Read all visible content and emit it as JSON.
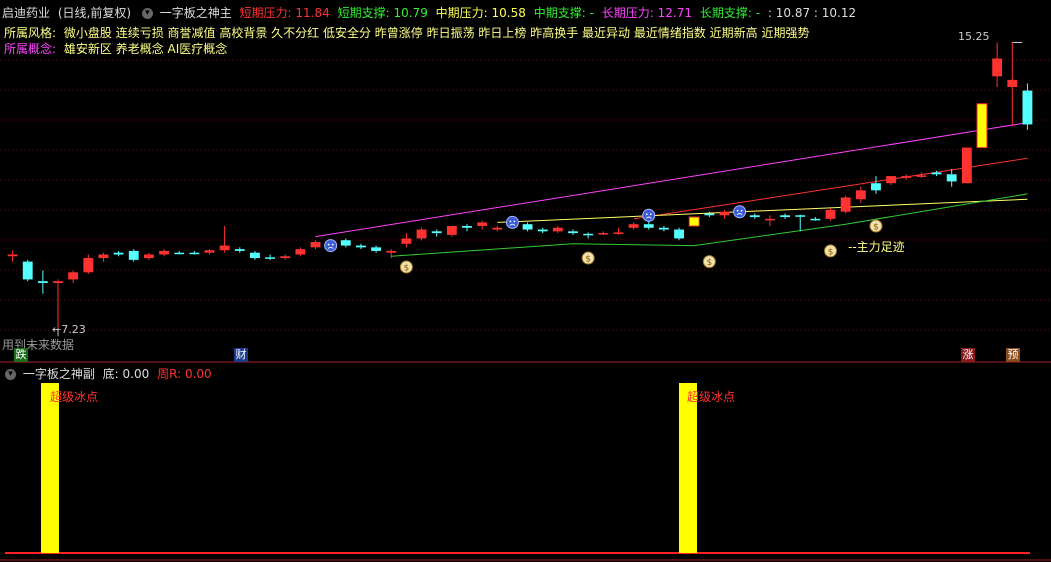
{
  "header": {
    "stock": "启迪药业",
    "period": "(日线,前复权)",
    "indicator": "一字板之神主",
    "short_pressure_label": "短期压力:",
    "short_pressure": "11.84",
    "short_support_label": "短期支撑:",
    "short_support": "10.79",
    "mid_pressure_label": "中期压力:",
    "mid_pressure": "10.58",
    "mid_support_label": "中期支撑:",
    "mid_support": "-",
    "long_pressure_label": "长期压力:",
    "long_pressure": "12.71",
    "long_support_label": "长期支撑:",
    "long_support": "-",
    "extra": ": 10.87 : 10.12"
  },
  "styles_row": {
    "label": "所属风格:",
    "value": "微小盘股 连续亏损 商誉减值 高校背景 久不分红 低安全分 昨曾涨停 昨日振荡 昨日上榜 昨高换手 最近异动 最近情绪指数 近期新高 近期强势"
  },
  "concepts_row": {
    "label": "所属概念:",
    "value": "雄安新区 养老概念 AI医疗概念"
  },
  "annotations": {
    "high_label": "15.25",
    "low_label": "←7.23",
    "main_force": "--主力足迹",
    "future_data": "用到未来数据",
    "marker_die": "跌",
    "marker_cai": "财",
    "marker_zhang": "涨",
    "marker_yu": "预"
  },
  "sub": {
    "title": "一字板之神副",
    "di_label": "底:",
    "di_value": "0.00",
    "zhou_label": "周R:",
    "zhou_value": "0.00",
    "bar_label": "超级冰点"
  },
  "colors": {
    "up": "#ff3232",
    "down": "#54ffff",
    "limit": "#ffff00",
    "short_line": "#ff44ff",
    "mid_line": "#ff3030",
    "long_line": "#ffff66",
    "support_line": "#33cc33"
  },
  "chart_data": {
    "type": "candlestick",
    "candles": [
      {
        "o": 9.3,
        "h": 9.4,
        "l": 9.1,
        "c": 9.25,
        "dir": "up"
      },
      {
        "o": 9.1,
        "h": 9.15,
        "l": 8.55,
        "c": 8.6,
        "dir": "down"
      },
      {
        "o": 8.55,
        "h": 8.85,
        "l": 8.2,
        "c": 8.5,
        "dir": "down"
      },
      {
        "o": 8.5,
        "h": 8.6,
        "l": 7.23,
        "c": 8.55,
        "dir": "up"
      },
      {
        "o": 8.6,
        "h": 8.85,
        "l": 8.5,
        "c": 8.8,
        "dir": "up"
      },
      {
        "o": 8.8,
        "h": 9.3,
        "l": 8.75,
        "c": 9.2,
        "dir": "up"
      },
      {
        "o": 9.2,
        "h": 9.35,
        "l": 9.1,
        "c": 9.3,
        "dir": "up"
      },
      {
        "o": 9.3,
        "h": 9.4,
        "l": 9.25,
        "c": 9.35,
        "dir": "down"
      },
      {
        "o": 9.4,
        "h": 9.45,
        "l": 9.1,
        "c": 9.15,
        "dir": "down"
      },
      {
        "o": 9.2,
        "h": 9.35,
        "l": 9.15,
        "c": 9.3,
        "dir": "up"
      },
      {
        "o": 9.3,
        "h": 9.45,
        "l": 9.25,
        "c": 9.4,
        "dir": "up"
      },
      {
        "o": 9.35,
        "h": 9.4,
        "l": 9.3,
        "c": 9.35,
        "dir": "down"
      },
      {
        "o": 9.35,
        "h": 9.4,
        "l": 9.3,
        "c": 9.35,
        "dir": "down"
      },
      {
        "o": 9.35,
        "h": 9.45,
        "l": 9.3,
        "c": 9.42,
        "dir": "up"
      },
      {
        "o": 9.42,
        "h": 10.1,
        "l": 9.35,
        "c": 9.55,
        "dir": "up"
      },
      {
        "o": 9.45,
        "h": 9.5,
        "l": 9.35,
        "c": 9.4,
        "dir": "down"
      },
      {
        "o": 9.35,
        "h": 9.4,
        "l": 9.15,
        "c": 9.2,
        "dir": "down"
      },
      {
        "o": 9.2,
        "h": 9.3,
        "l": 9.15,
        "c": 9.22,
        "dir": "down"
      },
      {
        "o": 9.2,
        "h": 9.3,
        "l": 9.15,
        "c": 9.25,
        "dir": "up"
      },
      {
        "o": 9.3,
        "h": 9.5,
        "l": 9.25,
        "c": 9.45,
        "dir": "up"
      },
      {
        "o": 9.5,
        "h": 9.7,
        "l": 9.45,
        "c": 9.65,
        "dir": "up"
      },
      {
        "o": 9.65,
        "h": 9.7,
        "l": 9.6,
        "c": 9.68,
        "dir": "down"
      },
      {
        "o": 9.7,
        "h": 9.75,
        "l": 9.5,
        "c": 9.55,
        "dir": "down"
      },
      {
        "o": 9.55,
        "h": 9.6,
        "l": 9.45,
        "c": 9.5,
        "dir": "down"
      },
      {
        "o": 9.5,
        "h": 9.55,
        "l": 9.35,
        "c": 9.4,
        "dir": "down"
      },
      {
        "o": 9.35,
        "h": 9.45,
        "l": 9.2,
        "c": 9.4,
        "dir": "up"
      },
      {
        "o": 9.6,
        "h": 9.9,
        "l": 9.5,
        "c": 9.75,
        "dir": "up"
      },
      {
        "o": 9.75,
        "h": 10.05,
        "l": 9.7,
        "c": 10.0,
        "dir": "up"
      },
      {
        "o": 9.9,
        "h": 10.0,
        "l": 9.8,
        "c": 9.95,
        "dir": "down"
      },
      {
        "o": 9.85,
        "h": 10.1,
        "l": 9.8,
        "c": 10.1,
        "dir": "up"
      },
      {
        "o": 10.05,
        "h": 10.15,
        "l": 9.95,
        "c": 10.1,
        "dir": "down"
      },
      {
        "o": 10.1,
        "h": 10.25,
        "l": 10.0,
        "c": 10.2,
        "dir": "up"
      },
      {
        "o": 10.0,
        "h": 10.1,
        "l": 9.95,
        "c": 10.05,
        "dir": "up"
      },
      {
        "o": 10.1,
        "h": 10.15,
        "l": 10.05,
        "c": 10.12,
        "dir": "up"
      },
      {
        "o": 10.15,
        "h": 10.2,
        "l": 9.95,
        "c": 10.0,
        "dir": "down"
      },
      {
        "o": 9.95,
        "h": 10.05,
        "l": 9.9,
        "c": 10.0,
        "dir": "down"
      },
      {
        "o": 9.95,
        "h": 10.1,
        "l": 9.9,
        "c": 10.05,
        "dir": "up"
      },
      {
        "o": 9.95,
        "h": 10.0,
        "l": 9.85,
        "c": 9.9,
        "dir": "down"
      },
      {
        "o": 9.88,
        "h": 9.92,
        "l": 9.75,
        "c": 9.85,
        "dir": "down"
      },
      {
        "o": 9.9,
        "h": 9.95,
        "l": 9.85,
        "c": 9.9,
        "dir": "up"
      },
      {
        "o": 9.9,
        "h": 10.05,
        "l": 9.85,
        "c": 9.92,
        "dir": "up"
      },
      {
        "o": 10.05,
        "h": 10.2,
        "l": 10.0,
        "c": 10.15,
        "dir": "up"
      },
      {
        "o": 10.15,
        "h": 10.25,
        "l": 10.0,
        "c": 10.05,
        "dir": "down"
      },
      {
        "o": 10.05,
        "h": 10.1,
        "l": 9.95,
        "c": 10.0,
        "dir": "down"
      },
      {
        "o": 10.0,
        "h": 10.05,
        "l": 9.7,
        "c": 9.75,
        "dir": "down"
      },
      {
        "o": 10.1,
        "h": 10.35,
        "l": 10.1,
        "c": 10.35,
        "dir": "limit"
      },
      {
        "o": 10.4,
        "h": 10.5,
        "l": 10.35,
        "c": 10.45,
        "dir": "down"
      },
      {
        "o": 10.4,
        "h": 10.55,
        "l": 10.3,
        "c": 10.5,
        "dir": "up"
      },
      {
        "o": 10.45,
        "h": 10.5,
        "l": 10.35,
        "c": 10.4,
        "dir": "down"
      },
      {
        "o": 10.4,
        "h": 10.45,
        "l": 10.3,
        "c": 10.35,
        "dir": "down"
      },
      {
        "o": 10.3,
        "h": 10.4,
        "l": 10.1,
        "c": 10.3,
        "dir": "up"
      },
      {
        "o": 10.35,
        "h": 10.45,
        "l": 10.3,
        "c": 10.4,
        "dir": "down"
      },
      {
        "o": 10.4,
        "h": 10.42,
        "l": 9.95,
        "c": 10.4,
        "dir": "down"
      },
      {
        "o": 10.3,
        "h": 10.35,
        "l": 10.25,
        "c": 10.3,
        "dir": "down"
      },
      {
        "o": 10.3,
        "h": 10.6,
        "l": 10.25,
        "c": 10.55,
        "dir": "up"
      },
      {
        "o": 10.5,
        "h": 10.95,
        "l": 10.45,
        "c": 10.9,
        "dir": "up"
      },
      {
        "o": 10.85,
        "h": 11.2,
        "l": 10.75,
        "c": 11.1,
        "dir": "up"
      },
      {
        "o": 11.1,
        "h": 11.5,
        "l": 11.0,
        "c": 11.3,
        "dir": "down"
      },
      {
        "o": 11.3,
        "h": 11.5,
        "l": 11.25,
        "c": 11.5,
        "dir": "up"
      },
      {
        "o": 11.45,
        "h": 11.55,
        "l": 11.4,
        "c": 11.5,
        "dir": "up"
      },
      {
        "o": 11.5,
        "h": 11.6,
        "l": 11.45,
        "c": 11.52,
        "dir": "up"
      },
      {
        "o": 11.6,
        "h": 11.65,
        "l": 11.5,
        "c": 11.55,
        "dir": "down"
      },
      {
        "o": 11.55,
        "h": 11.7,
        "l": 11.2,
        "c": 11.35,
        "dir": "down"
      },
      {
        "o": 11.3,
        "h": 12.3,
        "l": 11.3,
        "c": 12.3,
        "dir": "up"
      },
      {
        "o": 12.3,
        "h": 13.53,
        "l": 12.3,
        "c": 13.53,
        "dir": "limit"
      },
      {
        "o": 14.3,
        "h": 15.25,
        "l": 14.0,
        "c": 14.8,
        "dir": "up"
      },
      {
        "o": 14.2,
        "h": 15.25,
        "l": 12.9,
        "c": 14.0,
        "dir": "up"
      },
      {
        "o": 13.9,
        "h": 14.1,
        "l": 12.8,
        "c": 12.95,
        "dir": "down"
      }
    ],
    "sub_bars": [
      {
        "index": 2,
        "value": 1
      },
      {
        "index": 46,
        "value": 1
      }
    ]
  }
}
